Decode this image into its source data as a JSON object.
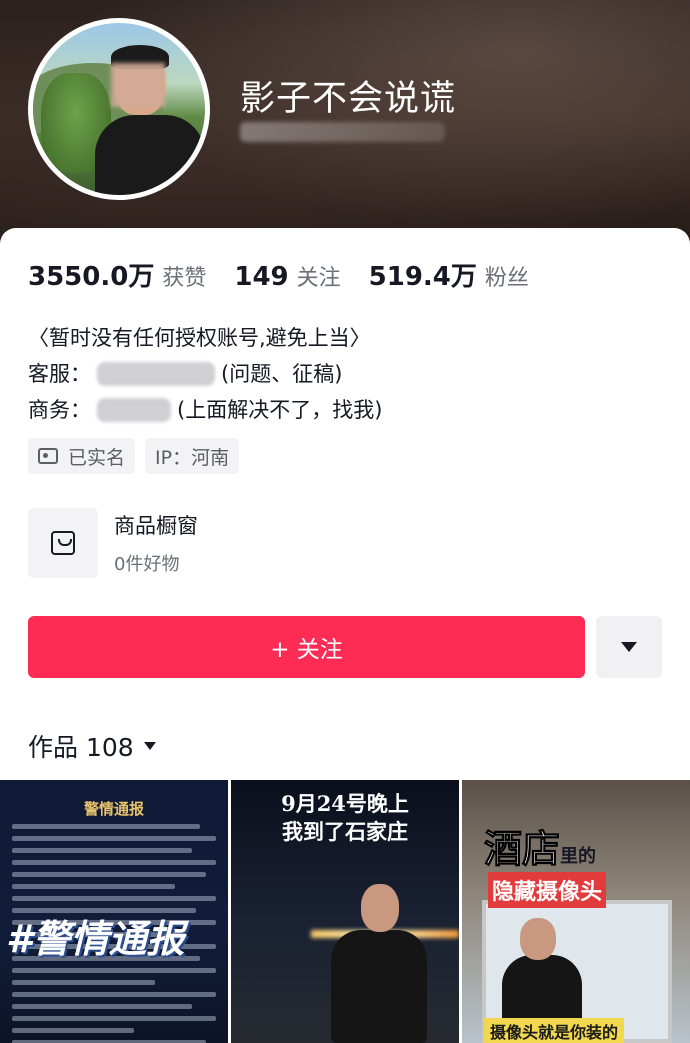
{
  "profile": {
    "username": "影子不会说谎"
  },
  "stats": {
    "likes_num": "3550.0万",
    "likes_label": "获赞",
    "following_num": "149",
    "following_label": "关注",
    "followers_num": "519.4万",
    "followers_label": "粉丝"
  },
  "bio": {
    "line1": "〈暂时没有任何授权账号,避免上当〉",
    "line2_label": "客服：",
    "line2_note": "(问题、征稿)",
    "line3_label": "商务：",
    "line3_note": "(上面解决不了，找我)"
  },
  "tags": {
    "verified": "已实名",
    "ip": "IP：河南"
  },
  "shop": {
    "title": "商品橱窗",
    "subtitle": "0件好物",
    "icon": "shopping-bag-icon"
  },
  "actions": {
    "follow_label": "+ 关注",
    "more_icon": "dropdown-triangle-icon"
  },
  "works": {
    "label": "作品 108"
  },
  "thumbnails": [
    {
      "title": "警情通报",
      "overlay": "#警情通报"
    },
    {
      "caption_line1": "9月24号晚上",
      "caption_line2": "我到了石家庄"
    },
    {
      "headline": "酒店",
      "headline_suffix": "里的",
      "subhead": "隐藏摄像头",
      "footer": "摄像头就是你装的"
    }
  ],
  "colors": {
    "follow_button": "#fe2c55",
    "tag_bg": "#f3f3f5",
    "secondary_text": "#6d6f78"
  }
}
